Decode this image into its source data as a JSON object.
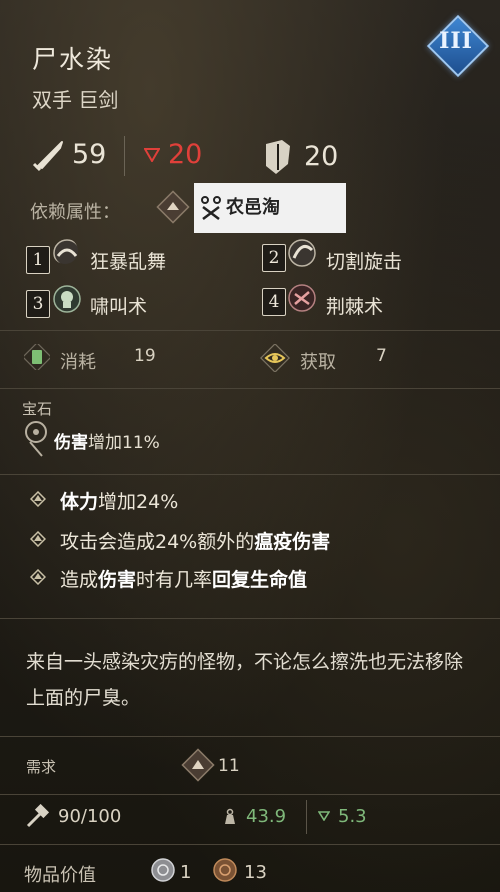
{
  "item": {
    "name": "尸水染",
    "type": "双手 巨剑",
    "tier": "III"
  },
  "stats": {
    "damage": "59",
    "poise_damage": "20",
    "block": "20"
  },
  "scaling": {
    "label": "依赖属性："
  },
  "watermark": {
    "text": "农邑淘"
  },
  "skills": [
    {
      "num": "1",
      "name": "狂暴乱舞"
    },
    {
      "num": "2",
      "name": "切割旋击"
    },
    {
      "num": "3",
      "name": "啸叫术"
    },
    {
      "num": "4",
      "name": "荆棘术"
    }
  ],
  "costs": {
    "consume_label": "消耗",
    "consume_value": "19",
    "obtain_label": "获取",
    "obtain_value": "7"
  },
  "gem": {
    "header": "宝石",
    "effect_bold": "伤害",
    "effect_rest": "增加11%"
  },
  "affixes": [
    {
      "pre": "",
      "bold1": "体力",
      "mid": "增加24%",
      "bold2": "",
      "post": ""
    },
    {
      "pre": "攻击会造成24%额外的",
      "bold1": "瘟疫伤害",
      "mid": "",
      "bold2": "",
      "post": ""
    },
    {
      "pre": "造成",
      "bold1": "伤害",
      "mid": "时有几率",
      "bold2": "回复生命值",
      "post": ""
    }
  ],
  "description": "来自一头感染灾疠的怪物，不论怎么擦洗也无法移除上面的尸臭。",
  "requirements": {
    "label": "需求",
    "value": "11"
  },
  "durability": {
    "text": "90/100",
    "weight": "43.9",
    "weight_delta": "5.3"
  },
  "value": {
    "label": "物品价值",
    "silver": "1",
    "bronze": "13"
  },
  "colors": {
    "red_stat": "#e0403a",
    "green_stat": "#7fb87a",
    "tier_blue": "#3e86d2"
  }
}
